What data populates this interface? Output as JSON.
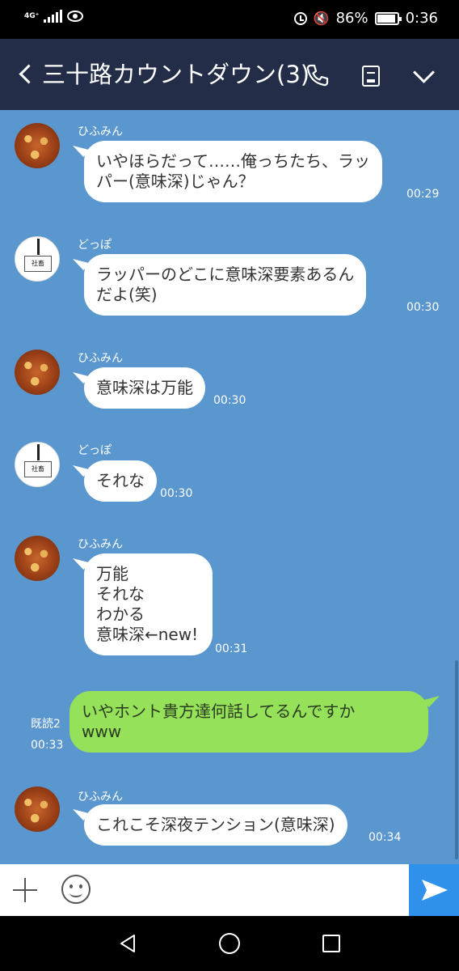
{
  "status_bar": {
    "network": "4G⁺",
    "battery": "86%",
    "time": "0:36"
  },
  "header": {
    "title": "三十路カウントダウン(3)"
  },
  "messages": [
    {
      "sender": "ひふみん",
      "lines": [
        "いやほらだって……俺っちたち、ラッ",
        "パー(意味深)じゃん？"
      ],
      "time": "00:29"
    },
    {
      "sender": "どっぽ",
      "lines": [
        "ラッパーのどこに意味深要素あるん",
        "だよ(笑)"
      ],
      "time": "00:30"
    },
    {
      "sender": "ひふみん",
      "lines": [
        "意味深は万能"
      ],
      "time": "00:30"
    },
    {
      "sender": "どっぽ",
      "lines": [
        "それな"
      ],
      "time": "00:30"
    },
    {
      "sender": "ひふみん",
      "lines": [
        "万能",
        "それな",
        "わかる",
        "意味深←new!"
      ],
      "time": "00:31"
    },
    {
      "sender": "",
      "lines": [
        "いやホント貴方達何話してるんですか",
        "www"
      ],
      "time": "00:33",
      "read": "既読2",
      "outgoing": true
    },
    {
      "sender": "ひふみん",
      "lines": [
        "これこそ深夜テンション(意味深)"
      ],
      "time": "00:34"
    }
  ],
  "avatars": {
    "dobbo_badge_text": "社畜"
  },
  "colors": {
    "header_bg": "#232d47",
    "chat_bg": "#5a97cf",
    "outgoing_bubble": "#95e159",
    "send_button": "#2f91e9"
  }
}
